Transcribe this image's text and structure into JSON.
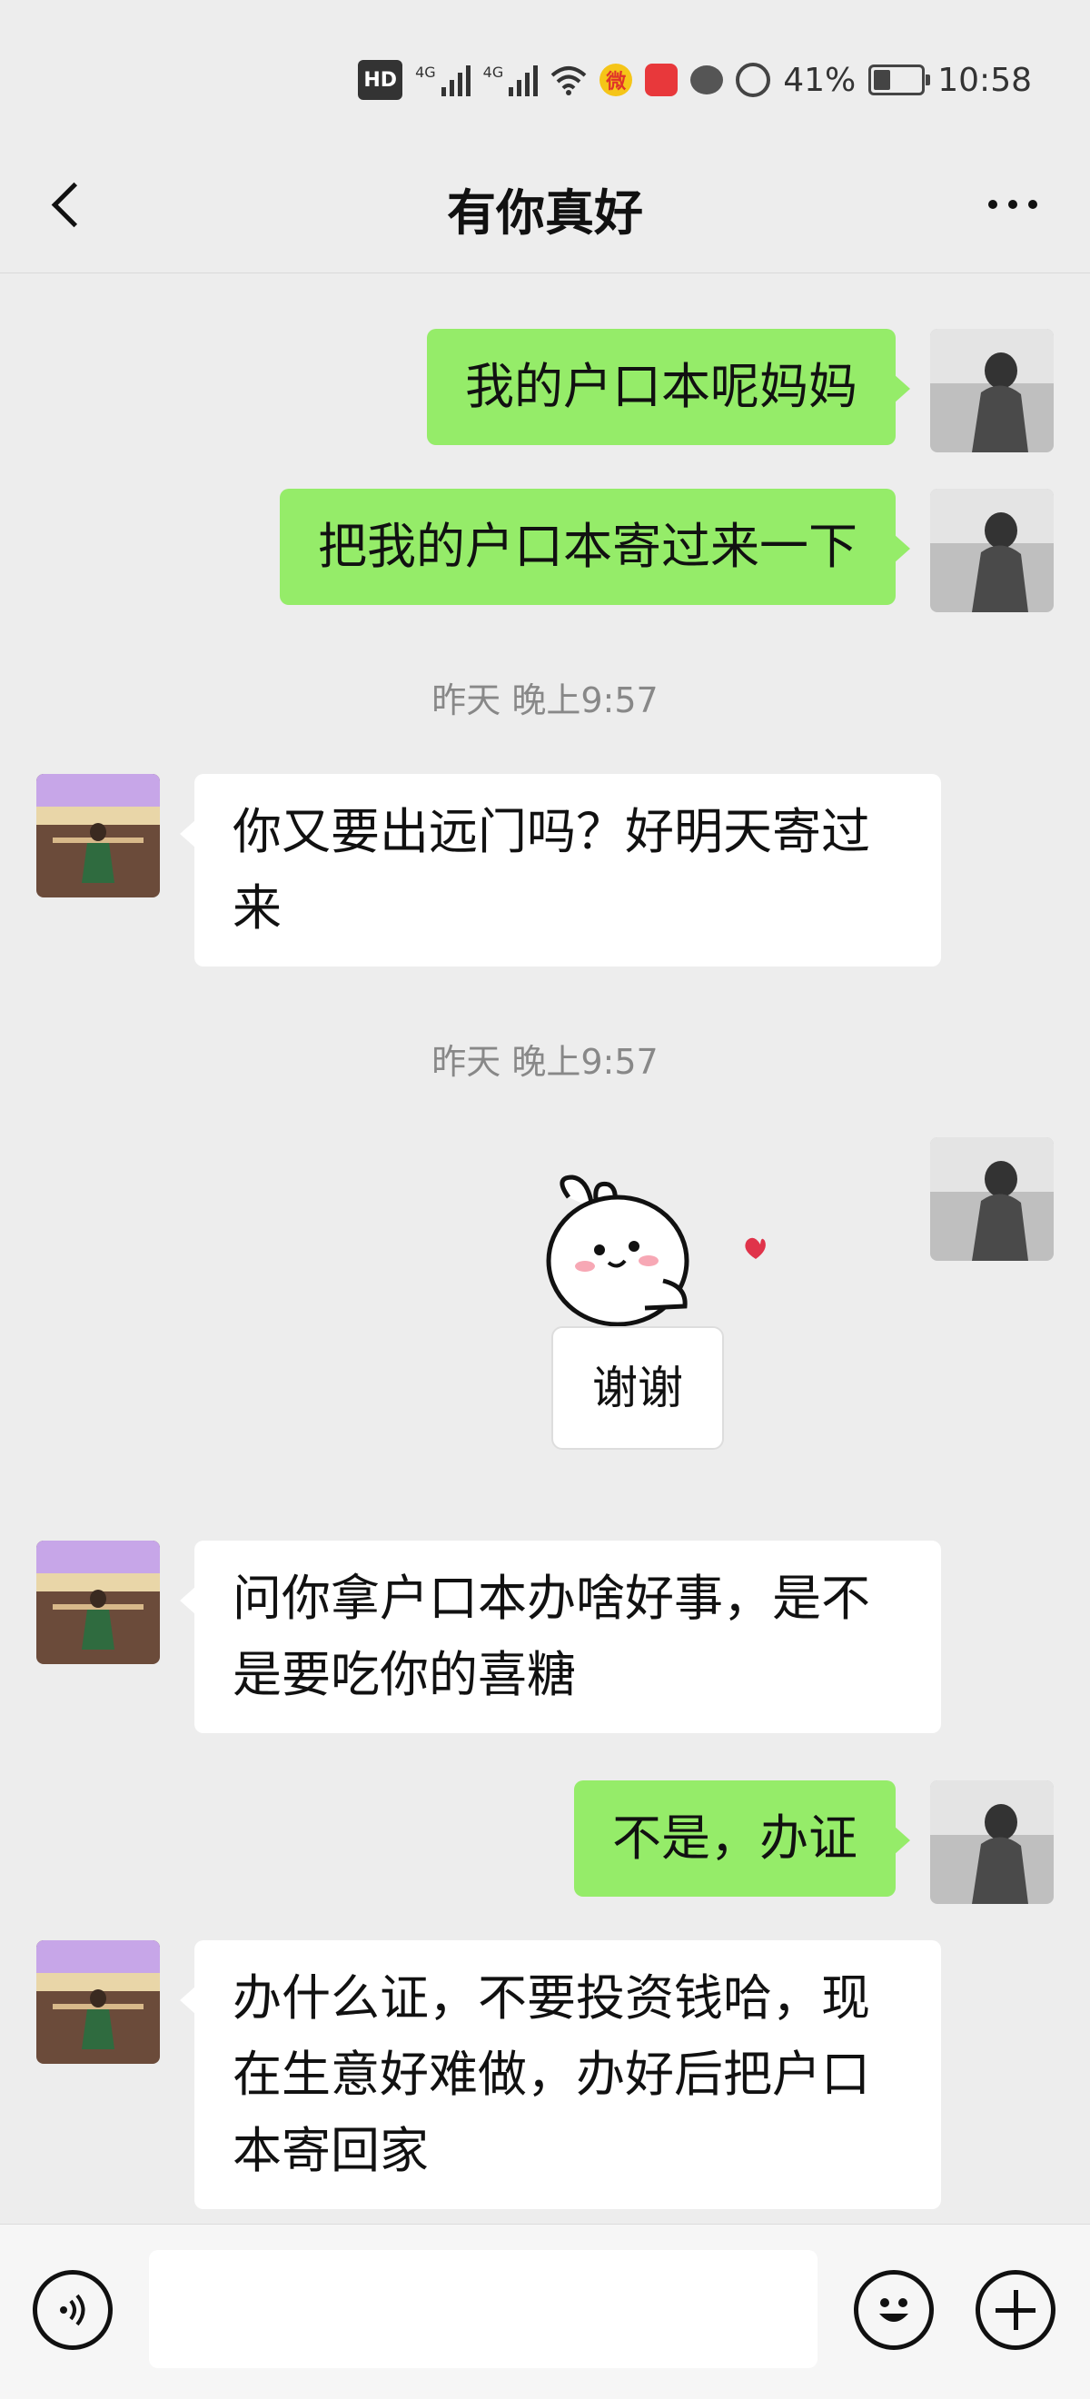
{
  "status_bar": {
    "hd_label": "HD",
    "network_1": "4G",
    "network_2": "4G",
    "battery": "41%",
    "battery_level": 0.41,
    "time": "10:58"
  },
  "header": {
    "title": "有你真好"
  },
  "messages": [
    {
      "from": "me",
      "text": "我的户口本呢妈妈"
    },
    {
      "from": "me",
      "text": "把我的户口本寄过来一下"
    },
    {
      "type": "time",
      "text": "昨天 晚上9:57"
    },
    {
      "from": "other",
      "text": "你又要出远门吗？好明天寄过来"
    },
    {
      "type": "time",
      "text": "昨天 晚上9:57"
    },
    {
      "from": "me",
      "type": "sticker",
      "text": "谢谢"
    },
    {
      "from": "other",
      "text": "问你拿户口本办啥好事，是不是要吃你的喜糖"
    },
    {
      "from": "me",
      "text": "不是，办证"
    },
    {
      "from": "other",
      "text": "办什么证，不要投资钱哈，现在生意好难做，办好后把户口本寄回家"
    }
  ],
  "input": {
    "value": ""
  },
  "colors": {
    "my_bubble": "#95ec69",
    "other_bubble": "#ffffff",
    "background": "#ededed"
  }
}
